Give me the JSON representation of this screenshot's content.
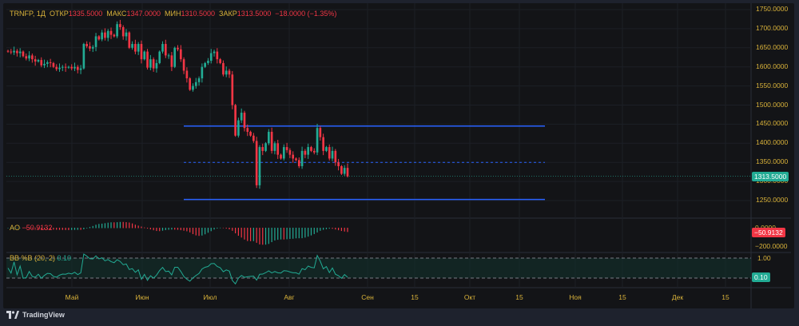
{
  "legend": {
    "symbol": "TRNFP, 1Д",
    "open_label": "ОТКР",
    "open": "1335.5000",
    "high_label": "МАКС",
    "high": "1347.0000",
    "low_label": "МИН",
    "low": "1310.5000",
    "close_label": "ЗАКР",
    "close": "1313.5000",
    "change": "−18.0000 (−1.35%)"
  },
  "ao": {
    "label": "AO",
    "value": "−50.9132",
    "axis": [
      "0.0000",
      "−200.0000"
    ],
    "tag": "−50.9132"
  },
  "bb": {
    "label": "BB %B (20, 2)",
    "value": "0.10",
    "axis": [
      "1.00"
    ],
    "tag": "0.10"
  },
  "price_axis": [
    "1750.0000",
    "1700.0000",
    "1650.0000",
    "1600.0000",
    "1550.0000",
    "1500.0000",
    "1450.0000",
    "1400.0000",
    "1350.0000",
    "1300.0000",
    "1250.0000"
  ],
  "last_price_tag": "1313.5000",
  "time_axis": [
    "Май",
    "Июн",
    "Июл",
    "Авг",
    "Сен",
    "15",
    "Окт",
    "15",
    "Ноя",
    "15",
    "Дек",
    "15"
  ],
  "levels": {
    "resistance": 1445,
    "mid": 1350,
    "support": 1253
  },
  "colors": {
    "up": "#22ab94",
    "down": "#f23645",
    "level": "#2962ff",
    "axis_text": "#d9b23a"
  },
  "brand": "TradingView",
  "chart_data": {
    "type": "candlestick",
    "symbol": "TRNFP",
    "interval": "1Д",
    "ylim": [
      1230,
      1760
    ],
    "closes": [
      1640,
      1638,
      1642,
      1636,
      1640,
      1628,
      1622,
      1630,
      1620,
      1614,
      1618,
      1604,
      1608,
      1612,
      1610,
      1600,
      1594,
      1598,
      1600,
      1598,
      1600,
      1596,
      1600,
      1592,
      1596,
      1660,
      1654,
      1648,
      1652,
      1680,
      1672,
      1690,
      1676,
      1694,
      1684,
      1680,
      1712,
      1704,
      1680,
      1690,
      1650,
      1660,
      1640,
      1660,
      1620,
      1640,
      1598,
      1620,
      1596,
      1610,
      1640,
      1660,
      1630,
      1630,
      1600,
      1650,
      1646,
      1620,
      1590,
      1570,
      1540,
      1550,
      1560,
      1570,
      1600,
      1610,
      1616,
      1636,
      1640,
      1620,
      1610,
      1580,
      1590,
      1580,
      1500,
      1420,
      1460,
      1480,
      1440,
      1430,
      1420,
      1406,
      1290,
      1390,
      1380,
      1400,
      1430,
      1380,
      1400,
      1370,
      1360,
      1390,
      1382,
      1370,
      1360,
      1356,
      1340,
      1380,
      1370,
      1390,
      1380,
      1376,
      1440,
      1416,
      1380,
      1390,
      1360,
      1380,
      1350,
      1340,
      1320,
      1335.5,
      1313.5
    ],
    "last": {
      "open": 1335.5,
      "high": 1347.0,
      "low": 1310.5,
      "close": 1313.5
    }
  }
}
